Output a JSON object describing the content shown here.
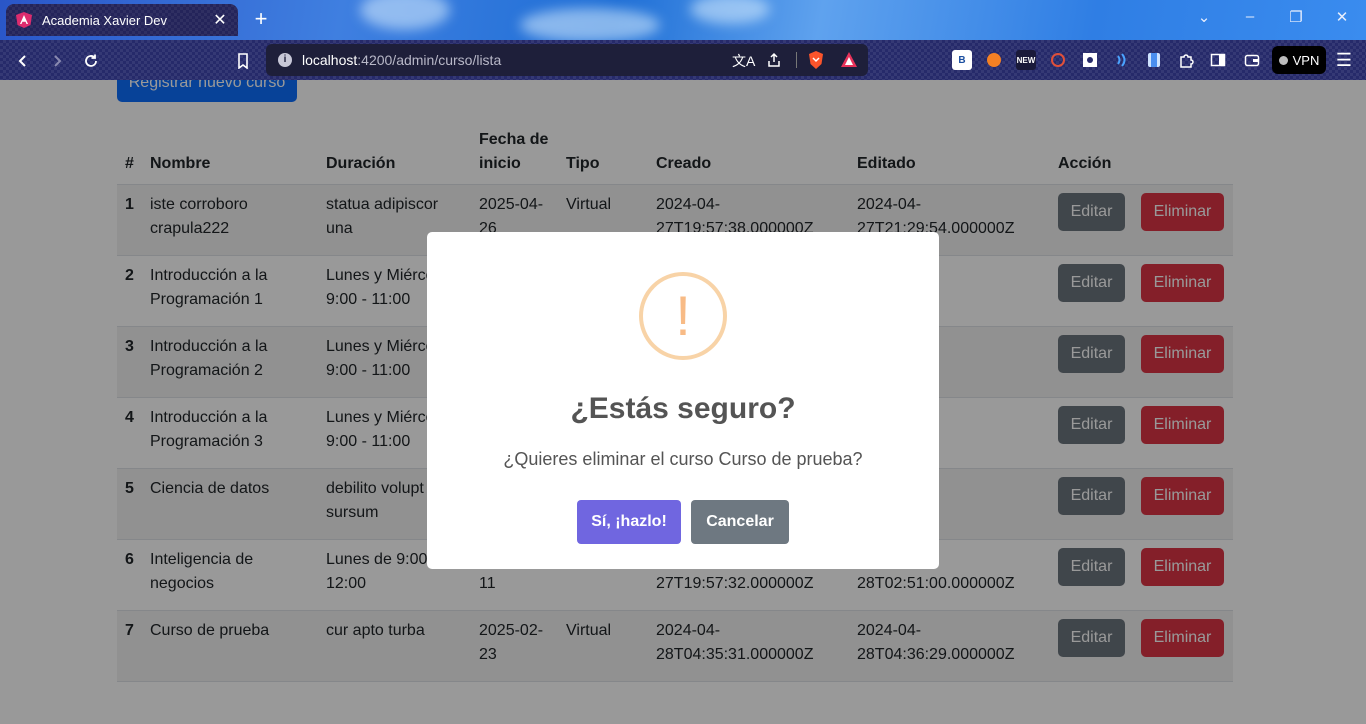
{
  "browser": {
    "tab_title": "Academia Xavier Dev",
    "url_host": "localhost",
    "url_path": ":4200/admin/curso/lista",
    "vpn_label": "VPN",
    "ext_new_label": "NEW",
    "ext_b_label": "B"
  },
  "page": {
    "register_button": "Registrar nuevo curso",
    "table": {
      "headers": {
        "num": "#",
        "nombre": "Nombre",
        "duracion": "Duración",
        "fecha_line1": "Fecha de",
        "fecha_line2": "inicio",
        "tipo": "Tipo",
        "creado": "Creado",
        "editado": "Editado",
        "accion": "Acción"
      },
      "edit_label": "Editar",
      "delete_label": "Eliminar",
      "rows": [
        {
          "num": "1",
          "nombre_1": "iste corroboro",
          "nombre_2": "crapula222",
          "duracion_1": "statua adipiscor",
          "duracion_2": "una",
          "fecha_1": "2025-04-",
          "fecha_2": "26",
          "tipo": "Virtual",
          "creado_1": "2024-04-",
          "creado_2": "27T19:57:38.000000Z",
          "editado_1": "2024-04-",
          "editado_2": "27T21:29:54.000000Z"
        },
        {
          "num": "2",
          "nombre_1": "Introducción a la",
          "nombre_2": "Programación 1",
          "duracion_1": "Lunes y Miérco",
          "duracion_2": "9:00 - 11:00",
          "editado_2": "0.000000Z"
        },
        {
          "num": "3",
          "nombre_1": "Introducción a la",
          "nombre_2": "Programación 2",
          "duracion_1": "Lunes y Miérco",
          "duracion_2": "9:00 - 11:00",
          "editado_2": "0.000000Z"
        },
        {
          "num": "4",
          "nombre_1": "Introducción a la",
          "nombre_2": "Programación 3",
          "duracion_1": "Lunes y Miérco",
          "duracion_2": "9:00 - 11:00",
          "editado_2": "8.000000Z"
        },
        {
          "num": "5",
          "nombre_1": "Ciencia de datos",
          "duracion_1": "debilito volupt",
          "duracion_2": "sursum",
          "editado_2": "1.000000Z"
        },
        {
          "num": "6",
          "nombre_1": "Inteligencia de",
          "nombre_2": "negocios",
          "duracion_1": "Lunes de 9:00",
          "duracion_2": "12:00",
          "fecha_2": "11",
          "creado_2": "27T19:57:32.000000Z",
          "editado_2": "28T02:51:00.000000Z"
        },
        {
          "num": "7",
          "nombre_1": "Curso de prueba",
          "duracion_1": "cur apto turba",
          "fecha_1": "2025-02-",
          "fecha_2": "23",
          "tipo": "Virtual",
          "creado_1": "2024-04-",
          "creado_2": "28T04:35:31.000000Z",
          "editado_1": "2024-04-",
          "editado_2": "28T04:36:29.000000Z"
        }
      ]
    }
  },
  "modal": {
    "icon_glyph": "!",
    "title": "¿Estás seguro?",
    "text": "¿Quieres eliminar el curso Curso de prueba?",
    "confirm_label": "Sí, ¡hazlo!",
    "cancel_label": "Cancelar"
  },
  "colors": {
    "accent_confirm": "#7066e0",
    "cancel": "#6e7881",
    "warning": "#f8bb86",
    "edit": "#6c757d",
    "delete": "#dc3545",
    "primary": "#0d6efd"
  }
}
